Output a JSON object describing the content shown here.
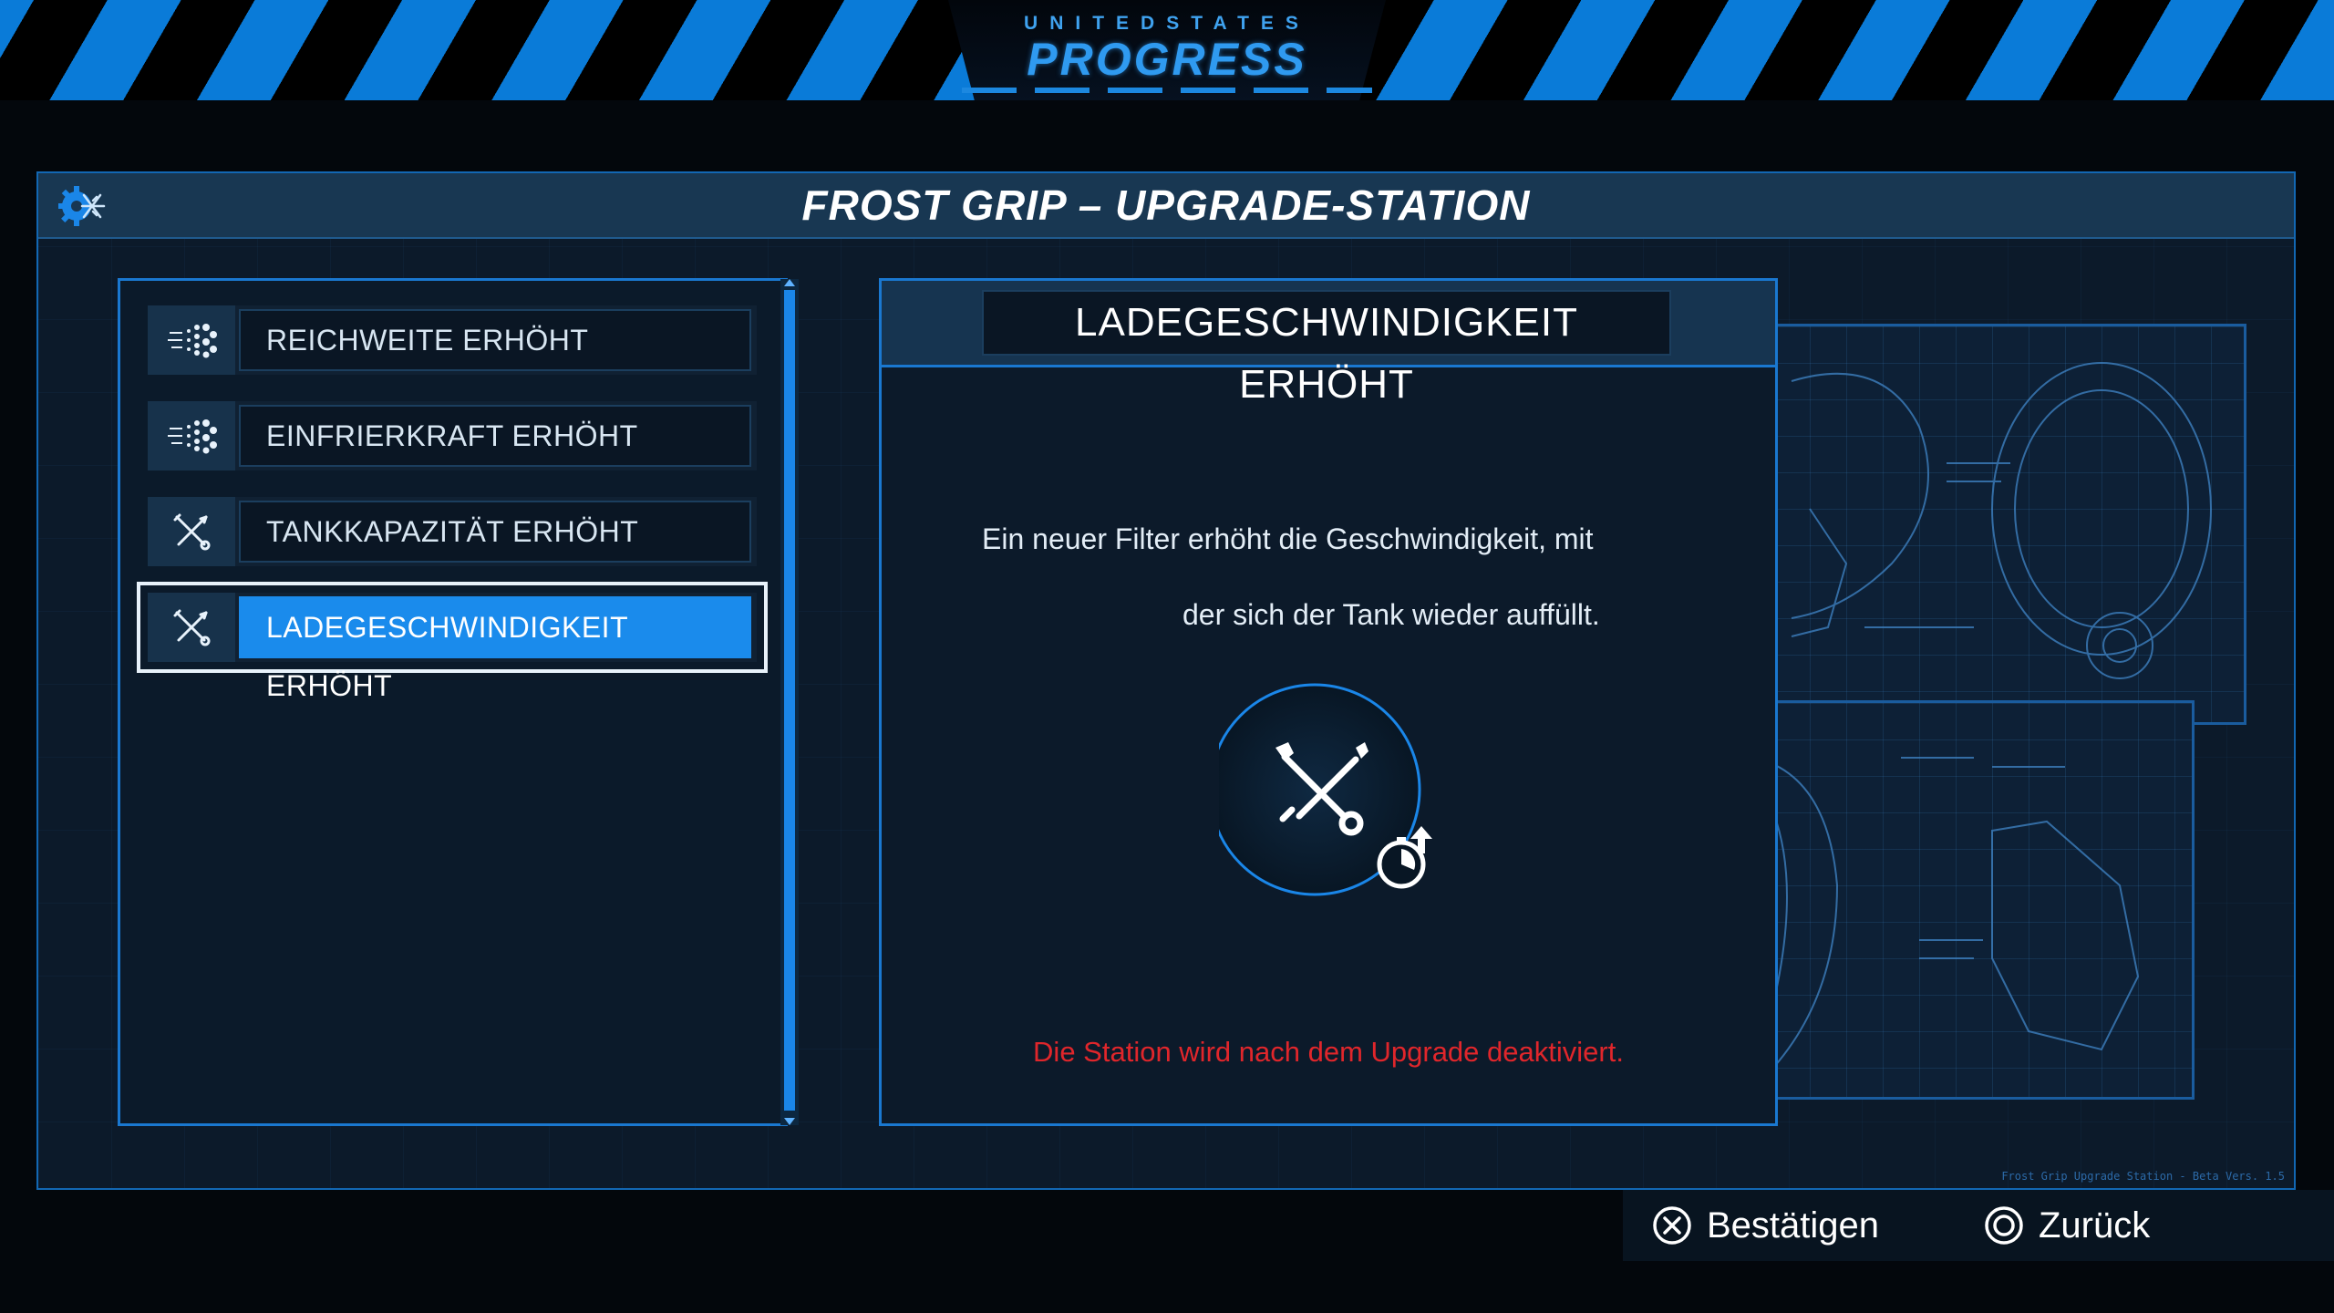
{
  "header": {
    "logo_top": "UNITEDSTATES",
    "logo_main": "PROGRESS"
  },
  "window": {
    "title": "FROST GRIP – UPGRADE-STATION",
    "icon": "snowflake-gear-icon"
  },
  "upgrades": [
    {
      "label": "REICHWEITE ERHÖHT",
      "icon": "spray-dots-icon",
      "selected": false
    },
    {
      "label": "EINFRIERKRAFT ERHÖHT",
      "icon": "spray-dots-icon",
      "selected": false
    },
    {
      "label": "TANKKAPAZITÄT ERHÖHT",
      "icon": "tools-icon",
      "selected": false
    },
    {
      "label": "LADEGESCHWINDIGKEIT ERHÖHT",
      "icon": "tools-icon",
      "selected": true
    }
  ],
  "detail": {
    "title": "LADEGESCHWINDIGKEIT ERHÖHT",
    "description_line1": "Ein neuer Filter erhöht die Geschwindigkeit, mit",
    "description_line2": "der sich der Tank wieder auffüllt.",
    "icon": "wrench-screwdriver-timer-up-icon",
    "warning": "Die Station wird nach dem Upgrade deaktiviert."
  },
  "blueprint": {
    "version_text": "Frost Grip Upgrade Station - Beta Vers. 1.5"
  },
  "footer": {
    "confirm_label": "Bestätigen",
    "confirm_icon": "cross-button-icon",
    "back_label": "Zurück",
    "back_icon": "circle-button-icon"
  },
  "colors": {
    "accent": "#1a8bec",
    "warning": "#e0262b",
    "panel_border": "#1a78d0"
  }
}
